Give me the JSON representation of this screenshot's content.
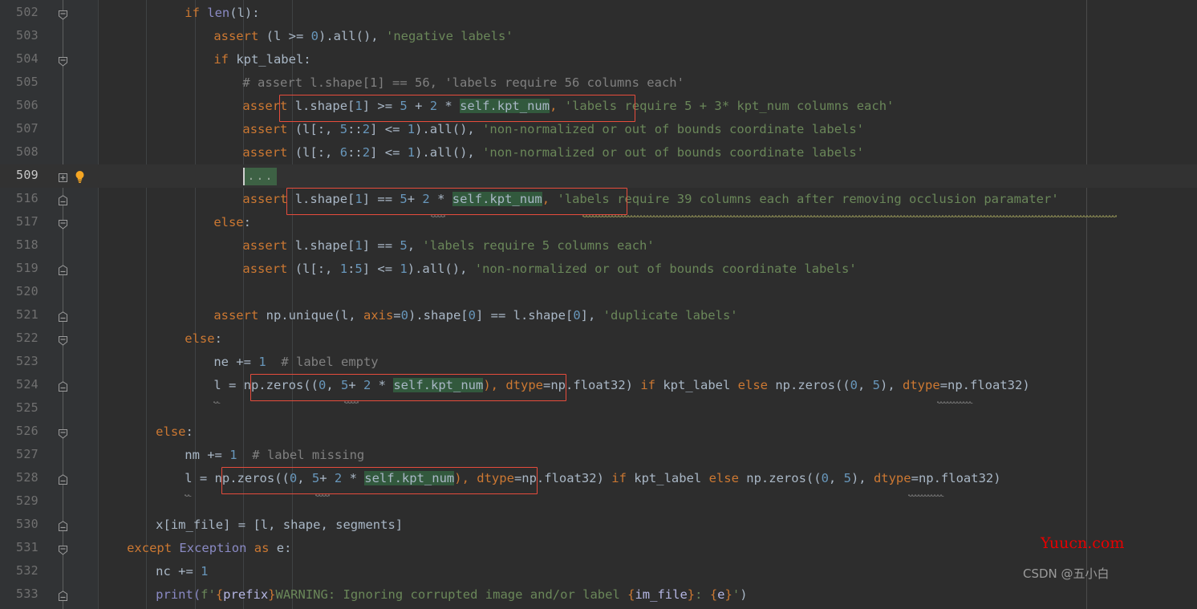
{
  "editor": {
    "background": "#2d2d2d",
    "gutter_background": "#313335",
    "current_line_background": "#323232",
    "accent_box_color": "#e74c3c",
    "search_highlight_color": "#32593d",
    "right_margin_column_x": 1354
  },
  "colors": {
    "keyword": "#cc7832",
    "string": "#6a8759",
    "number": "#6897bb",
    "comment": "#808080",
    "function": "#8a8ac4",
    "default_text": "#a9b7c6",
    "line_number": "#707070",
    "current_line_number": "#c8c8c8",
    "indent_guide": "#3f4244",
    "watermark_red": "#e60000",
    "watermark_grey": "#9a9a9a"
  },
  "lines": [
    {
      "num": "502",
      "fold": "collapse-arrow",
      "current": false
    },
    {
      "num": "503",
      "fold": "none",
      "current": false
    },
    {
      "num": "504",
      "fold": "collapse-arrow",
      "current": false
    },
    {
      "num": "505",
      "fold": "none",
      "current": false
    },
    {
      "num": "506",
      "fold": "none",
      "current": false
    },
    {
      "num": "507",
      "fold": "none",
      "current": false
    },
    {
      "num": "508",
      "fold": "none",
      "current": false
    },
    {
      "num": "509",
      "fold": "expand-plus",
      "current": true,
      "bulb": true
    },
    {
      "num": "516",
      "fold": "collapse-minus",
      "current": false
    },
    {
      "num": "517",
      "fold": "collapse-arrow",
      "current": false
    },
    {
      "num": "518",
      "fold": "none",
      "current": false
    },
    {
      "num": "519",
      "fold": "collapse-minus",
      "current": false
    },
    {
      "num": "520",
      "fold": "none",
      "current": false
    },
    {
      "num": "521",
      "fold": "collapse-minus",
      "current": false
    },
    {
      "num": "522",
      "fold": "collapse-arrow",
      "current": false
    },
    {
      "num": "523",
      "fold": "none",
      "current": false
    },
    {
      "num": "524",
      "fold": "collapse-minus",
      "current": false
    },
    {
      "num": "525",
      "fold": "none",
      "current": false
    },
    {
      "num": "526",
      "fold": "collapse-arrow",
      "current": false
    },
    {
      "num": "527",
      "fold": "none",
      "current": false
    },
    {
      "num": "528",
      "fold": "collapse-minus",
      "current": false
    },
    {
      "num": "529",
      "fold": "none",
      "current": false
    },
    {
      "num": "530",
      "fold": "collapse-minus",
      "current": false
    },
    {
      "num": "531",
      "fold": "collapse-arrow",
      "current": false
    },
    {
      "num": "532",
      "fold": "none",
      "current": false
    },
    {
      "num": "533",
      "fold": "collapse-minus",
      "current": false
    }
  ],
  "code_text": {
    "l502": "            if len(l):",
    "l503": "                assert (l >= 0).all(), 'negative labels'",
    "l504": "                if kpt_label:",
    "l505": "                    # assert l.shape[1] == 56, 'labels require 56 columns each'",
    "l506": "                    assert l.shape[1] >= 5 + 2 * self.kpt_num, 'labels require 5 + 3* kpt_num columns each'",
    "l507": "                    assert (l[:, 5::2] <= 1).all(), 'non-normalized or out of bounds coordinate labels'",
    "l508": "                    assert (l[:, 6::2] <= 1).all(), 'non-normalized or out of bounds coordinate labels'",
    "l509": "                    ...",
    "l516": "                    assert l.shape[1] == 5+ 2 * self.kpt_num, 'labels require 39 columns each after removing occlusion paramater'",
    "l517": "                else:",
    "l518": "                    assert l.shape[1] == 5, 'labels require 5 columns each'",
    "l519": "                    assert (l[:, 1:5] <= 1).all(), 'non-normalized or out of bounds coordinate labels'",
    "l520": "",
    "l521": "                assert np.unique(l, axis=0).shape[0] == l.shape[0], 'duplicate labels'",
    "l522": "            else:",
    "l523": "                ne += 1  # label empty",
    "l524": "                l = np.zeros((0, 5+ 2 * self.kpt_num), dtype=np.float32) if kpt_label else np.zeros((0, 5), dtype=np.float32)",
    "l525": "",
    "l526": "        else:",
    "l527": "            nm += 1  # label missing",
    "l528": "            l = np.zeros((0, 5+ 2 * self.kpt_num), dtype=np.float32) if kpt_label else np.zeros((0, 5), dtype=np.float32)",
    "l529": "",
    "l530": "        x[im_file] = [l, shape, segments]",
    "l531": "    except Exception as e:",
    "l532": "        nc += 1",
    "l533": "        print(f'{prefix}WARNING: Ignoring corrupted image and/or label {im_file}: {e}')"
  },
  "tokens": {
    "l502": [
      {
        "t": "if",
        "c": "kw"
      },
      {
        "t": " ",
        "c": ""
      },
      {
        "t": "len",
        "c": "fn"
      },
      {
        "t": "(l)",
        "c": "var"
      },
      {
        "t": ":",
        "c": "var"
      }
    ],
    "l503": [
      {
        "t": "assert",
        "c": "kw"
      },
      {
        "t": " (l >= ",
        "c": "var"
      },
      {
        "t": "0",
        "c": "num"
      },
      {
        "t": ").all(), ",
        "c": "var"
      },
      {
        "t": "'negative labels'",
        "c": "str"
      }
    ],
    "l504": [
      {
        "t": "if",
        "c": "kw"
      },
      {
        "t": " kpt_label:",
        "c": "var"
      }
    ],
    "l505": [
      {
        "t": "# assert l.shape[1] == 56, 'labels require 56 columns each'",
        "c": "cmt"
      }
    ],
    "l506": [
      {
        "t": "assert",
        "c": "kw"
      },
      {
        "t": " l.shape[",
        "c": "var"
      },
      {
        "t": "1",
        "c": "num"
      },
      {
        "t": "] >= ",
        "c": "var"
      },
      {
        "t": "5",
        "c": "num"
      },
      {
        "t": " + ",
        "c": "var"
      },
      {
        "t": "2",
        "c": "num"
      },
      {
        "t": " * ",
        "c": "var"
      },
      {
        "t": "self.kpt_num",
        "c": "hl"
      },
      {
        "t": ",",
        "c": "kw"
      },
      {
        "t": " ",
        "c": "var"
      },
      {
        "t": "'labels require 5 + 3* kpt_num columns each'",
        "c": "str"
      }
    ],
    "l507": [
      {
        "t": "assert",
        "c": "kw"
      },
      {
        "t": " (l[:, ",
        "c": "var"
      },
      {
        "t": "5",
        "c": "num"
      },
      {
        "t": "::",
        "c": "var"
      },
      {
        "t": "2",
        "c": "num"
      },
      {
        "t": "] <= ",
        "c": "var"
      },
      {
        "t": "1",
        "c": "num"
      },
      {
        "t": ").all(), ",
        "c": "var"
      },
      {
        "t": "'non-normalized or out of bounds coordinate labels'",
        "c": "str"
      }
    ],
    "l508": [
      {
        "t": "assert",
        "c": "kw"
      },
      {
        "t": " (l[:, ",
        "c": "var"
      },
      {
        "t": "6",
        "c": "num"
      },
      {
        "t": "::",
        "c": "var"
      },
      {
        "t": "2",
        "c": "num"
      },
      {
        "t": "] <= ",
        "c": "var"
      },
      {
        "t": "1",
        "c": "num"
      },
      {
        "t": ").all(), ",
        "c": "var"
      },
      {
        "t": "'non-normalized or out of bounds coordinate labels'",
        "c": "str"
      }
    ],
    "l516": [
      {
        "t": "assert",
        "c": "kw"
      },
      {
        "t": " l.shape[",
        "c": "var"
      },
      {
        "t": "1",
        "c": "num"
      },
      {
        "t": "] == ",
        "c": "var"
      },
      {
        "t": "5",
        "c": "num"
      },
      {
        "t": "+ ",
        "c": "var"
      },
      {
        "t": "2",
        "c": "num"
      },
      {
        "t": " * ",
        "c": "var"
      },
      {
        "t": "self.kpt_num",
        "c": "hl"
      },
      {
        "t": ",",
        "c": "kw"
      },
      {
        "t": " ",
        "c": "var"
      },
      {
        "t": "'labels require 39 columns each after removing occlusion paramater'",
        "c": "str"
      }
    ],
    "l517": [
      {
        "t": "else",
        "c": "kw"
      },
      {
        "t": ":",
        "c": "var"
      }
    ],
    "l518": [
      {
        "t": "assert",
        "c": "kw"
      },
      {
        "t": " l.shape[",
        "c": "var"
      },
      {
        "t": "1",
        "c": "num"
      },
      {
        "t": "] == ",
        "c": "var"
      },
      {
        "t": "5",
        "c": "num"
      },
      {
        "t": ", ",
        "c": "var"
      },
      {
        "t": "'labels require 5 columns each'",
        "c": "str"
      }
    ],
    "l519": [
      {
        "t": "assert",
        "c": "kw"
      },
      {
        "t": " (l[:, ",
        "c": "var"
      },
      {
        "t": "1",
        "c": "num"
      },
      {
        "t": ":",
        "c": "var"
      },
      {
        "t": "5",
        "c": "num"
      },
      {
        "t": "] <= ",
        "c": "var"
      },
      {
        "t": "1",
        "c": "num"
      },
      {
        "t": ").all(), ",
        "c": "var"
      },
      {
        "t": "'non-normalized or out of bounds coordinate labels'",
        "c": "str"
      }
    ],
    "l521": [
      {
        "t": "assert",
        "c": "kw"
      },
      {
        "t": " np.unique(l, ",
        "c": "var"
      },
      {
        "t": "axis",
        "c": "kwarg"
      },
      {
        "t": "=",
        "c": "var"
      },
      {
        "t": "0",
        "c": "num"
      },
      {
        "t": ").shape[",
        "c": "var"
      },
      {
        "t": "0",
        "c": "num"
      },
      {
        "t": "] == l.shape[",
        "c": "var"
      },
      {
        "t": "0",
        "c": "num"
      },
      {
        "t": "], ",
        "c": "var"
      },
      {
        "t": "'duplicate labels'",
        "c": "str"
      }
    ],
    "l522": [
      {
        "t": "else",
        "c": "kw"
      },
      {
        "t": ":",
        "c": "var"
      }
    ],
    "l523": [
      {
        "t": "ne += ",
        "c": "var"
      },
      {
        "t": "1",
        "c": "num"
      },
      {
        "t": "  ",
        "c": "var"
      },
      {
        "t": "# label empty",
        "c": "cmt"
      }
    ],
    "l524": [
      {
        "t": "l = np.zeros((",
        "c": "var"
      },
      {
        "t": "0",
        "c": "num"
      },
      {
        "t": ", ",
        "c": "var"
      },
      {
        "t": "5",
        "c": "num"
      },
      {
        "t": "+ ",
        "c": "var"
      },
      {
        "t": "2",
        "c": "num"
      },
      {
        "t": " * ",
        "c": "var"
      },
      {
        "t": "self.kpt_num",
        "c": "hl"
      },
      {
        "t": "),",
        "c": "kw"
      },
      {
        "t": " ",
        "c": "var"
      },
      {
        "t": "dtype",
        "c": "kwarg"
      },
      {
        "t": "=np.float32) ",
        "c": "var"
      },
      {
        "t": "if",
        "c": "kw"
      },
      {
        "t": " kpt_label ",
        "c": "var"
      },
      {
        "t": "else",
        "c": "kw"
      },
      {
        "t": " np.zeros((",
        "c": "var"
      },
      {
        "t": "0",
        "c": "num"
      },
      {
        "t": ", ",
        "c": "var"
      },
      {
        "t": "5",
        "c": "num"
      },
      {
        "t": "), ",
        "c": "var"
      },
      {
        "t": "dtype",
        "c": "kwarg"
      },
      {
        "t": "=np.float32)",
        "c": "var"
      }
    ],
    "l526": [
      {
        "t": "else",
        "c": "kw"
      },
      {
        "t": ":",
        "c": "var"
      }
    ],
    "l527": [
      {
        "t": "nm += ",
        "c": "var"
      },
      {
        "t": "1",
        "c": "num"
      },
      {
        "t": "  ",
        "c": "var"
      },
      {
        "t": "# label missing",
        "c": "cmt"
      }
    ],
    "l528": [
      {
        "t": "l = np.zeros((",
        "c": "var"
      },
      {
        "t": "0",
        "c": "num"
      },
      {
        "t": ", ",
        "c": "var"
      },
      {
        "t": "5",
        "c": "num"
      },
      {
        "t": "+ ",
        "c": "var"
      },
      {
        "t": "2",
        "c": "num"
      },
      {
        "t": " * ",
        "c": "var"
      },
      {
        "t": "self.kpt_num",
        "c": "hl"
      },
      {
        "t": "),",
        "c": "kw"
      },
      {
        "t": " ",
        "c": "var"
      },
      {
        "t": "dtype",
        "c": "kwarg"
      },
      {
        "t": "=np.float32) ",
        "c": "var"
      },
      {
        "t": "if",
        "c": "kw"
      },
      {
        "t": " kpt_label ",
        "c": "var"
      },
      {
        "t": "else",
        "c": "kw"
      },
      {
        "t": " np.zeros((",
        "c": "var"
      },
      {
        "t": "0",
        "c": "num"
      },
      {
        "t": ", ",
        "c": "var"
      },
      {
        "t": "5",
        "c": "num"
      },
      {
        "t": "), ",
        "c": "var"
      },
      {
        "t": "dtype",
        "c": "kwarg"
      },
      {
        "t": "=np.float32)",
        "c": "var"
      }
    ],
    "l530": [
      {
        "t": "x[im_file] = [l, shape, segments]",
        "c": "var"
      }
    ],
    "l531": [
      {
        "t": "except",
        "c": "kw"
      },
      {
        "t": " ",
        "c": "var"
      },
      {
        "t": "Exception",
        "c": "cls"
      },
      {
        "t": " ",
        "c": "var"
      },
      {
        "t": "as",
        "c": "kw"
      },
      {
        "t": " e:",
        "c": "var"
      }
    ],
    "l532": [
      {
        "t": "nc += ",
        "c": "var"
      },
      {
        "t": "1",
        "c": "num"
      }
    ],
    "l533": [
      {
        "t": "print(",
        "c": "fn"
      },
      {
        "t": "f'",
        "c": "str"
      },
      {
        "t": "{",
        "c": "fstr-br"
      },
      {
        "t": "prefix",
        "c": "deco"
      },
      {
        "t": "}",
        "c": "fstr-br"
      },
      {
        "t": "WARNING: Ignoring corrupted image and/or label ",
        "c": "str"
      },
      {
        "t": "{",
        "c": "fstr-br"
      },
      {
        "t": "im_file",
        "c": "deco"
      },
      {
        "t": "}",
        "c": "fstr-br"
      },
      {
        "t": ": ",
        "c": "str"
      },
      {
        "t": "{",
        "c": "fstr-br"
      },
      {
        "t": "e",
        "c": "deco"
      },
      {
        "t": "}",
        "c": "fstr-br"
      },
      {
        "t": "'",
        "c": "str"
      },
      {
        "t": ")",
        "c": "var"
      }
    ]
  },
  "folded_region": {
    "label": "...",
    "line": "509"
  },
  "annotations": {
    "red_boxes": [
      {
        "target_line": "506",
        "label": "marked-assert-kpt-num"
      },
      {
        "target_line": "516",
        "label": "marked-assert-eq-kpt-num"
      },
      {
        "target_line": "524",
        "label": "marked-zeros-kpt-num"
      },
      {
        "target_line": "528",
        "label": "marked-zeros-kpt-num-2"
      }
    ],
    "intention_bulb": {
      "line": "509",
      "icon": "lightbulb-icon"
    }
  },
  "watermarks": {
    "site": "Yuucn.com",
    "author": "CSDN @五小白"
  }
}
